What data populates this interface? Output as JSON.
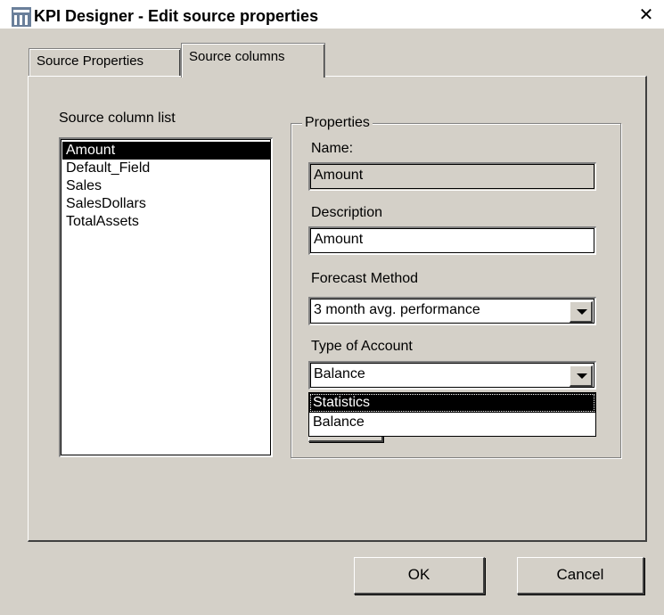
{
  "window": {
    "title": "KPI Designer - Edit source properties",
    "close_glyph": "✕"
  },
  "tabs": [
    {
      "label": "Source Properties",
      "active": false
    },
    {
      "label": "Source columns",
      "active": true
    }
  ],
  "source_list": {
    "label": "Source column list",
    "items": [
      "Amount",
      "Default_Field",
      "Sales",
      "SalesDollars",
      "TotalAssets"
    ],
    "selected": "Amount"
  },
  "properties": {
    "group_label": "Properties",
    "name_label": "Name:",
    "name_value": "Amount",
    "description_label": "Description",
    "description_value": "Amount",
    "forecast_label": "Forecast Method",
    "forecast_value": "3 month avg. performance",
    "account_label": "Type of Account",
    "account_value": "Balance",
    "account_options": [
      "Statistics",
      "Balance"
    ],
    "account_highlighted": "Statistics"
  },
  "buttons": {
    "ok": "OK",
    "cancel": "Cancel"
  },
  "icons": {
    "app": "kpi-designer-app-icon",
    "close": "close-icon",
    "combo_arrow": "chevron-down-icon"
  }
}
